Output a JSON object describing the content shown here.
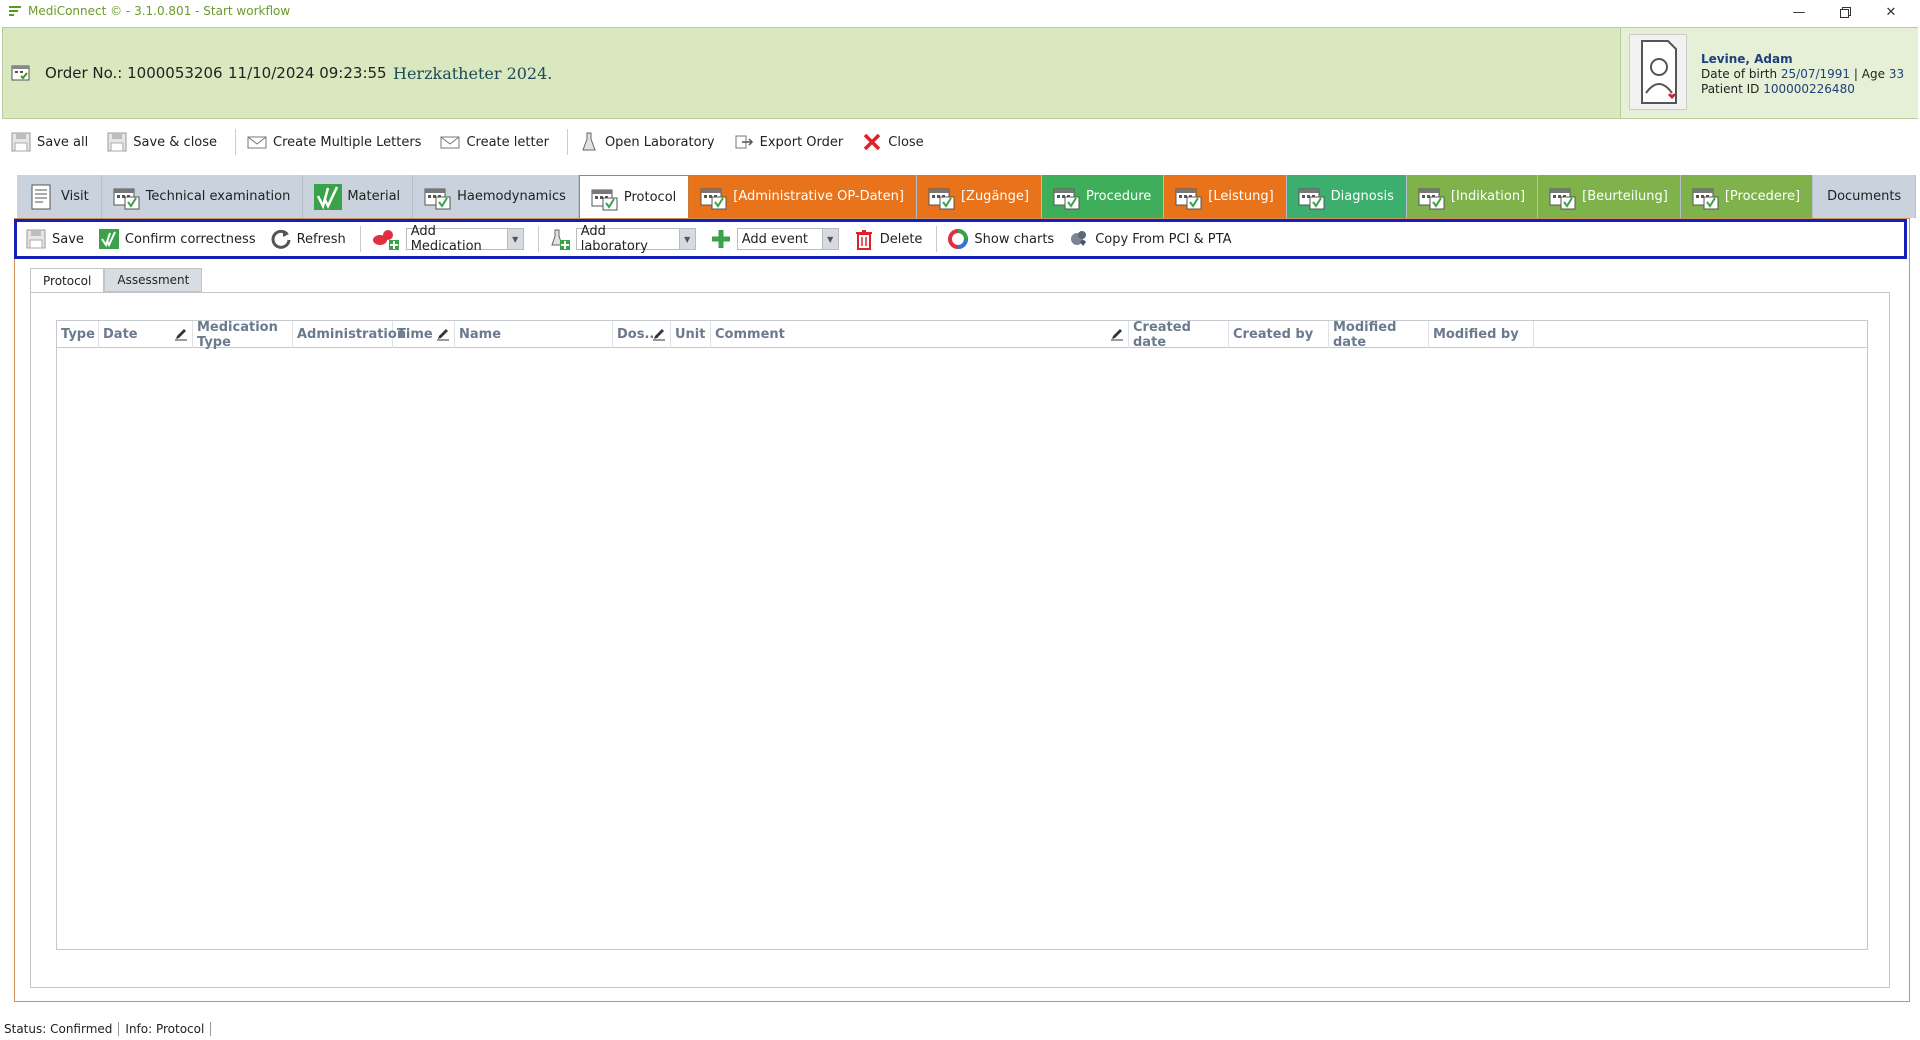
{
  "window": {
    "title": "MediConnect © - 3.1.0.801 - Start workflow",
    "controls": [
      "minimize-icon",
      "restore-icon",
      "close-icon"
    ]
  },
  "header": {
    "order_label": "Order No.: 1000053206",
    "order_datetime": "11/10/2024 09:23:55",
    "order_title": "Herzkatheter 2024.",
    "patient": {
      "name": "Levine, Adam",
      "dob_label": "Date of birth",
      "dob_value": "25/07/1991",
      "age_label": "| Age",
      "age_value": "33",
      "id_label": "Patient ID",
      "id_value": "100000226480"
    }
  },
  "toolbar": {
    "save_all": "Save all",
    "save_close": "Save & close",
    "create_multiple_letters": "Create Multiple Letters",
    "create_letter": "Create letter",
    "open_laboratory": "Open Laboratory",
    "export_order": "Export Order",
    "close": "Close"
  },
  "module_tabs": [
    {
      "label": "Visit",
      "style": "default"
    },
    {
      "label": "Technical examination",
      "style": "default"
    },
    {
      "label": "Material",
      "style": "default"
    },
    {
      "label": "Haemodynamics",
      "style": "default"
    },
    {
      "label": "Protocol",
      "style": "active"
    },
    {
      "label": "[Administrative OP-Daten]",
      "style": "orange"
    },
    {
      "label": "[Zugänge]",
      "style": "orange"
    },
    {
      "label": "Procedure",
      "style": "green"
    },
    {
      "label": "[Leistung]",
      "style": "orange"
    },
    {
      "label": "Diagnosis",
      "style": "teal"
    },
    {
      "label": "[Indikation]",
      "style": "olive"
    },
    {
      "label": "[Beurteilung]",
      "style": "olive"
    },
    {
      "label": "[Procedere]",
      "style": "olive"
    },
    {
      "label": "Documents",
      "style": "default"
    }
  ],
  "protocol_toolbar": {
    "save": "Save",
    "confirm": "Confirm correctness",
    "refresh": "Refresh",
    "add_medication": "Add Medication",
    "add_laboratory": "Add laboratory",
    "add_event": "Add event",
    "delete": "Delete",
    "show_charts": "Show charts",
    "copy_from": "Copy From PCI & PTA"
  },
  "inner_tabs": [
    "Protocol",
    "Assessment"
  ],
  "grid": {
    "columns": [
      "Type",
      "Date",
      "Medication Type",
      "Administration",
      "Time",
      "Name",
      "Dos...",
      "Unit",
      "Comment",
      "Created date",
      "Created by",
      "Modified date",
      "Modified by"
    ],
    "rows": []
  },
  "status": {
    "status": "Status: Confirmed",
    "info": "Info: Protocol"
  },
  "colors": {
    "header_bg": "#d9e8bf",
    "tab_orange": "#e8731a",
    "tab_green": "#3fae5a",
    "tab_olive": "#7fb24a",
    "highlight_border": "#1520b8"
  }
}
